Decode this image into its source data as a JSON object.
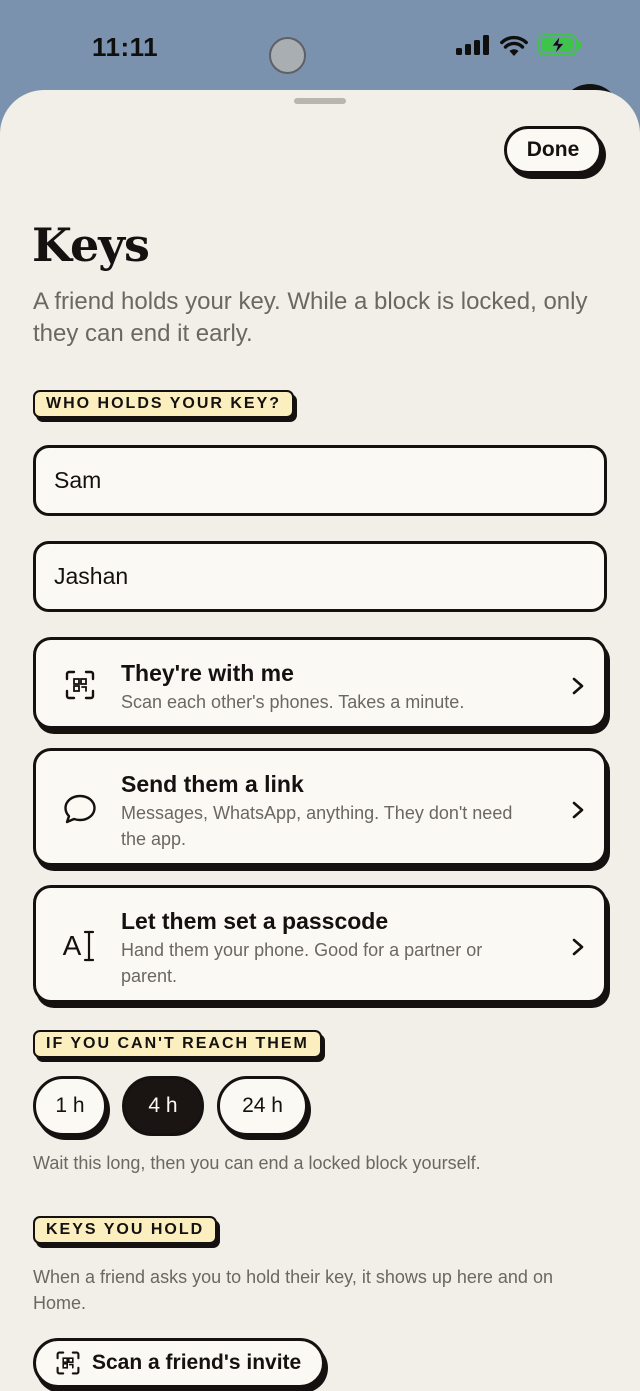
{
  "status_bar": {
    "time": "11:11"
  },
  "header": {
    "done_label": "Done"
  },
  "page": {
    "title": "Keys",
    "subtitle": "A friend holds your key. While a block is locked, only they can end it early."
  },
  "holders": {
    "tag": "WHO HOLDS YOUR KEY?",
    "names": [
      "Sam",
      "Jashan"
    ]
  },
  "options": [
    {
      "icon": "qr-scan-icon",
      "title": "They're with me",
      "desc": "Scan each other's phones. Takes a minute."
    },
    {
      "icon": "chat-bubble-icon",
      "title": "Send them a link",
      "desc": "Messages, WhatsApp, anything. They don't need the app."
    },
    {
      "icon": "text-cursor-icon",
      "glyph": "A",
      "title": "Let them set a passcode",
      "desc": "Hand them your phone. Good for a partner or parent."
    }
  ],
  "fallback": {
    "tag": "IF YOU CAN'T REACH THEM",
    "durations": [
      "1 h",
      "4 h",
      "24 h"
    ],
    "selected": "4 h",
    "hint": "Wait this long, then you can end a locked block yourself."
  },
  "keys_you_hold": {
    "tag": "KEYS YOU HOLD",
    "hint": "When a friend asks you to hold their key, it shows up here and on Home.",
    "scan_label": "Scan a friend's invite"
  },
  "colors": {
    "accent_tag": "#fbefc0",
    "ink": "#141110",
    "sheet": "#f2efe8",
    "battery": "#3ec44a"
  }
}
